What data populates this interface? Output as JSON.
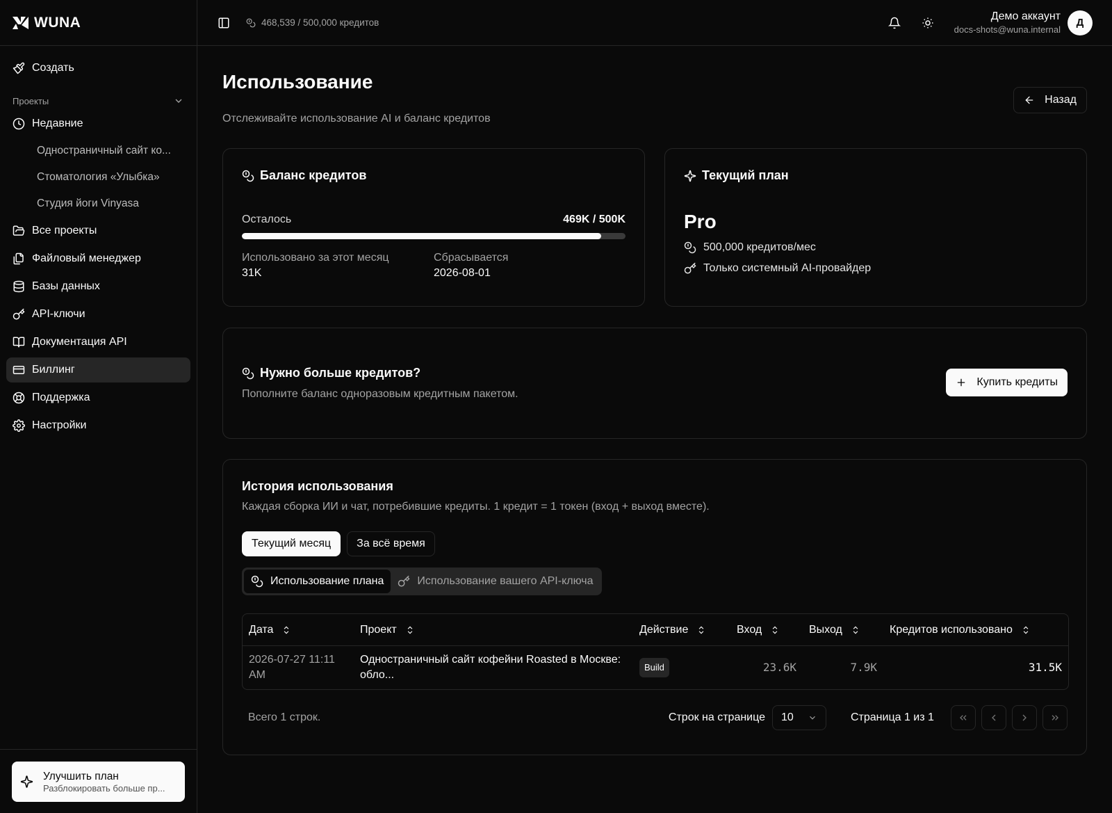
{
  "brand": {
    "name": "WUNA"
  },
  "sidebar": {
    "create_label": "Создать",
    "projects_label": "Проекты",
    "recent_label": "Недавние",
    "recent_items": [
      "Одностраничный сайт ко...",
      "Стоматология «Улыбка»",
      "Студия йоги Vinyasa"
    ],
    "items": [
      {
        "label": "Все проекты",
        "icon": "folder-open-icon"
      },
      {
        "label": "Файловый менеджер",
        "icon": "files-icon"
      },
      {
        "label": "Базы данных",
        "icon": "database-icon"
      },
      {
        "label": "API-ключи",
        "icon": "key-icon"
      },
      {
        "label": "Документация API",
        "icon": "book-icon"
      },
      {
        "label": "Биллинг",
        "icon": "credit-card-icon",
        "active": true
      },
      {
        "label": "Поддержка",
        "icon": "life-buoy-icon"
      },
      {
        "label": "Настройки",
        "icon": "gear-icon"
      }
    ],
    "upgrade": {
      "title": "Улучшить план",
      "subtitle": "Разблокировать больше пр..."
    }
  },
  "topbar": {
    "credits": "468,539 / 500,000 кредитов",
    "user_name": "Демо аккаунт",
    "user_email": "docs-shots@wuna.internal",
    "avatar_letter": "Д"
  },
  "page": {
    "title": "Использование",
    "subtitle": "Отслеживайте использование AI и баланс кредитов",
    "back_label": "Назад"
  },
  "balance": {
    "title": "Баланс кредитов",
    "remaining_label": "Осталось",
    "remaining_value": "469K / 500K",
    "remaining_fraction": 0.937,
    "used_label": "Использовано за этот месяц",
    "used_value": "31K",
    "reset_label": "Сбрасывается",
    "reset_value": "2026-08-01"
  },
  "plan": {
    "title": "Текущий план",
    "name": "Pro",
    "features": [
      "500,000 кредитов/мес",
      "Только системный AI-провайдер"
    ]
  },
  "buy": {
    "title": "Нужно больше кредитов?",
    "subtitle": "Пополните баланс одноразовым кредитным пакетом.",
    "button_label": "Купить кредиты"
  },
  "history": {
    "title": "История использования",
    "subtitle": "Каждая сборка ИИ и чат, потребившие кредиты. 1 кредит = 1 токен (вход + выход вместе).",
    "range_tabs": [
      "Текущий месяц",
      "За всё время"
    ],
    "source_tabs": [
      "Использование плана",
      "Использование вашего API-ключа"
    ],
    "columns": [
      "Дата",
      "Проект",
      "Действие",
      "Вход",
      "Выход",
      "Кредитов использовано"
    ],
    "rows": [
      {
        "date": "2026-07-27 11:11 AM",
        "project": "Одностраничный сайт кофейни Roasted в Москве: обло...",
        "action": "Build",
        "input": "23.6K",
        "output": "7.9K",
        "credits": "31.5K"
      }
    ],
    "total_rows": "Всего 1 строк.",
    "rows_per_page_label": "Строк на странице",
    "rows_per_page_value": "10",
    "page_info": "Страница 1 из 1"
  }
}
